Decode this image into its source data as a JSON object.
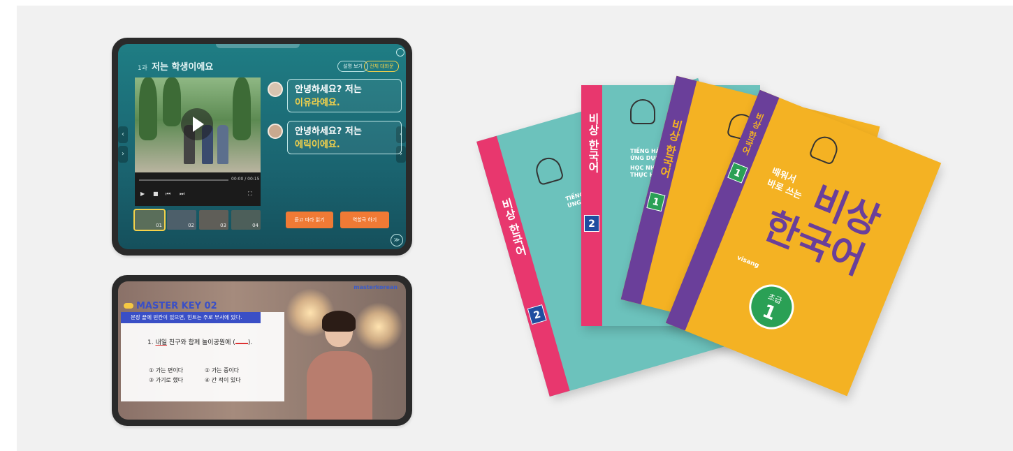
{
  "tablet1": {
    "lesson_number": "1과",
    "lesson_title": "저는 학생이에요",
    "pill_explain": "설명 보기",
    "pill_full": "전체 대화문",
    "video_time": "00:00 / 00:15",
    "bubble1_line1": "안녕하세요? 저는",
    "bubble1_line2": "이유라예요.",
    "bubble2_line1": "안녕하세요? 저는",
    "bubble2_line2": "에릭이에요.",
    "thumbs": [
      "01",
      "02",
      "03",
      "04"
    ],
    "btn_listen": "듣고 따라 읽기",
    "btn_role": "역할극 하기",
    "corner_icon": "≫"
  },
  "tablet2": {
    "brand": "masterkorean",
    "title": "MASTER KEY 02",
    "banner": "문장 끝에 빈칸이 있으면, 힌트는 주로 부사에 있다.",
    "q_prefix": "1.",
    "q_word": "내일",
    "q_rest": "친구와 함께 놀이공원에 (",
    "q_end": ").",
    "opt1": "① 가는 편이다",
    "opt2": "② 가는 중이다",
    "opt3": "③ 가기로 했다",
    "opt4": "④ 간 적이 있다"
  },
  "books": {
    "title_line1": "비상",
    "title_line2": "한국어",
    "sub_line1": "배워서",
    "sub_line2": "바로 쓰는",
    "vn_line1": "TIẾNG HÀN",
    "vn_line2": "ỨNG DỤNG",
    "vn_line3": "HỌC NHANH",
    "vn_line4": "THỰC HÀNH",
    "spine_title": "비상 한국어",
    "level_label": "초급",
    "level_num_1": "1",
    "level_num_2": "2",
    "publisher": "visang"
  },
  "colors": {
    "teal": "#6cc2bc",
    "yellow": "#f4b223",
    "pink": "#e8376e",
    "purple": "#6a3f9a",
    "green": "#2aa055",
    "orange_button": "#f07a35"
  }
}
